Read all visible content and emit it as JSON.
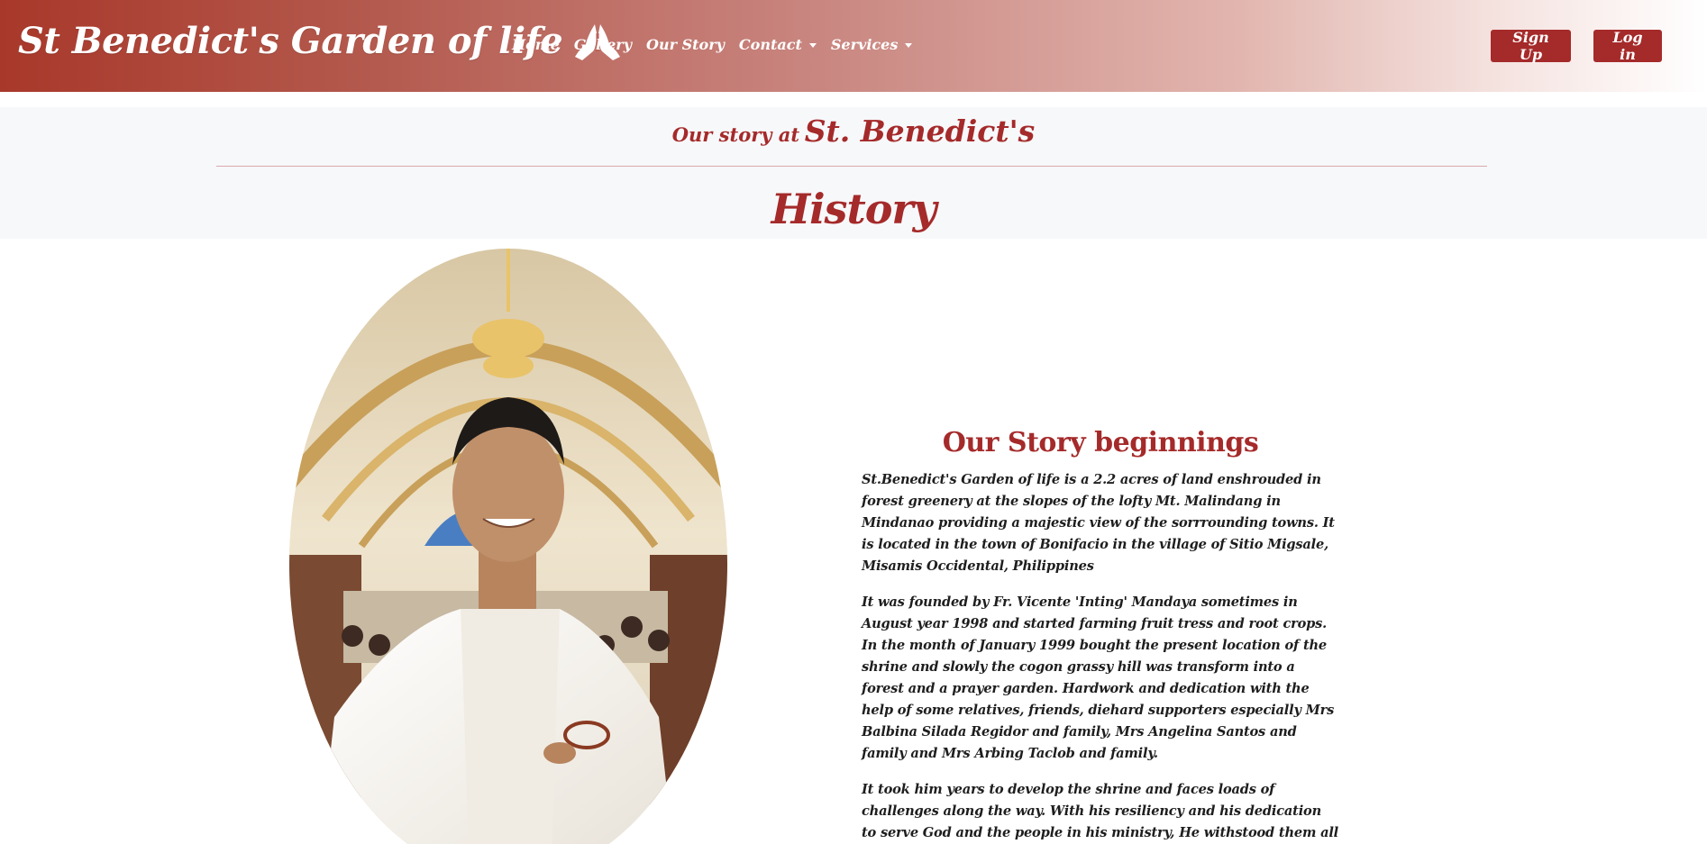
{
  "navbar": {
    "brand": "St Benedict's Garden of life",
    "brand_icon": "praying-hands-icon",
    "links": [
      {
        "label": "Home",
        "dropdown": false
      },
      {
        "label": "Gallery",
        "dropdown": false
      },
      {
        "label": "Our Story",
        "dropdown": false
      },
      {
        "label": "Contact",
        "dropdown": true
      },
      {
        "label": "Services",
        "dropdown": true
      }
    ],
    "signup_label": "Sign Up",
    "login_label": "Log in"
  },
  "header": {
    "prefix": "Our story at",
    "name": "St. Benedict's",
    "title": "History"
  },
  "story": {
    "heading": "Our Story beginnings",
    "paragraphs": [
      "St.Benedict's Garden of life is a 2.2 acres of land enshrouded in forest greenery at the slopes of the lofty Mt. Malindang in Mindanao providing a majestic view of the sorrrounding towns. It is located in the town of Bonifacio in the village of Sitio Migsale, Misamis Occidental, Philippines",
      "It was founded by Fr. Vicente 'Inting' Mandaya sometimes in August year 1998 and started farming fruit tress and root crops. In the month of January 1999 bought the present location of the shrine and slowly the cogon grassy hill was transform into a forest and a prayer garden. Hardwork and dedication with the help of some relatives, friends, diehard supporters especially Mrs Balbina Silada Regidor and family, Mrs Angelina Santos and family and Mrs Arbing Taclob and family.",
      "It took him years to develop the shrine and faces loads of challenges along the way. With his resiliency and his dedication to serve God and the people in his ministry, He withstood them all and continued developing the St.Benedict's Garden of life."
    ]
  },
  "colors": {
    "accent": "#a52a2a",
    "navbar_start": "#a8382a",
    "band_bg": "#f7f8fa"
  }
}
